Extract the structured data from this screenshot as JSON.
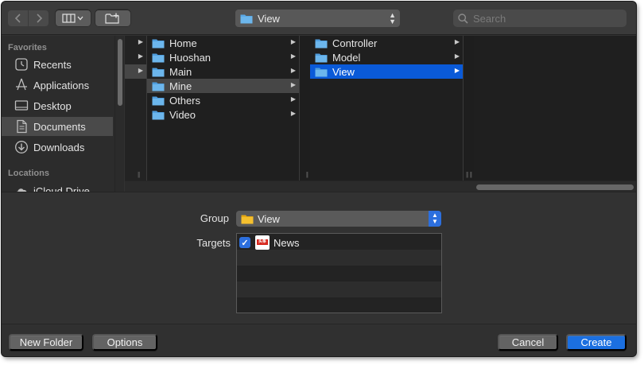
{
  "toolbar": {
    "back_icon": "chevron-left-icon",
    "forward_icon": "chevron-right-icon",
    "view_icon": "column-view-icon",
    "new_folder_icon": "folder-plus-icon",
    "path_label": "View",
    "search_placeholder": "Search"
  },
  "sidebar": {
    "favorites_heading": "Favorites",
    "locations_heading": "Locations",
    "items": [
      {
        "label": "Recents",
        "icon": "clock-icon",
        "selected": false
      },
      {
        "label": "Applications",
        "icon": "applications-icon",
        "selected": false
      },
      {
        "label": "Desktop",
        "icon": "desktop-icon",
        "selected": false
      },
      {
        "label": "Documents",
        "icon": "document-icon",
        "selected": true
      },
      {
        "label": "Downloads",
        "icon": "download-icon",
        "selected": false
      }
    ],
    "locations": [
      {
        "label": "iCloud Drive",
        "icon": "cloud-icon"
      }
    ]
  },
  "browser": {
    "column1": [
      "Home",
      "Huoshan",
      "Main",
      "Mine",
      "Others",
      "Video"
    ],
    "column1_selected": "Mine",
    "column2": [
      "Controller",
      "Model",
      "View"
    ],
    "column2_selected": "View"
  },
  "accessory": {
    "group_label": "Group",
    "group_value": "View",
    "targets_label": "Targets",
    "targets": [
      {
        "name": "News",
        "checked": true
      }
    ],
    "app_icon_text": "头条"
  },
  "footer": {
    "new_folder": "New Folder",
    "options": "Options",
    "cancel": "Cancel",
    "create": "Create"
  },
  "colors": {
    "accent": "#1b6fe0",
    "selection_blue": "#0a5ad8",
    "folder_blue": "#5aa9e6",
    "folder_yellow": "#f5c02e"
  }
}
